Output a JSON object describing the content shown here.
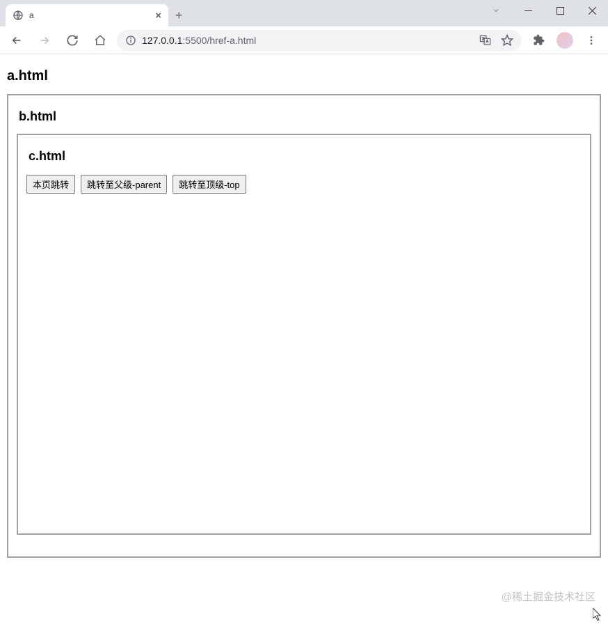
{
  "browser": {
    "tab_title": "a",
    "address_host": "127.0.0.1",
    "address_port": ":5500",
    "address_path": "/href-a.html"
  },
  "page": {
    "a_heading": "a.html",
    "b_heading": "b.html",
    "c_heading": "c.html",
    "buttons": {
      "self": "本页跳转",
      "parent": "跳转至父级-parent",
      "top": "跳转至顶级-top"
    }
  },
  "watermark": "@稀土掘金技术社区",
  "icons": {
    "globe": "globe-icon",
    "close": "close-icon",
    "plus": "plus-icon",
    "back": "back-icon",
    "forward": "forward-icon",
    "reload": "reload-icon",
    "home": "home-icon",
    "info": "info-icon",
    "translate": "translate-icon",
    "star": "star-icon",
    "puzzle": "puzzle-icon",
    "menu": "menu-icon"
  }
}
